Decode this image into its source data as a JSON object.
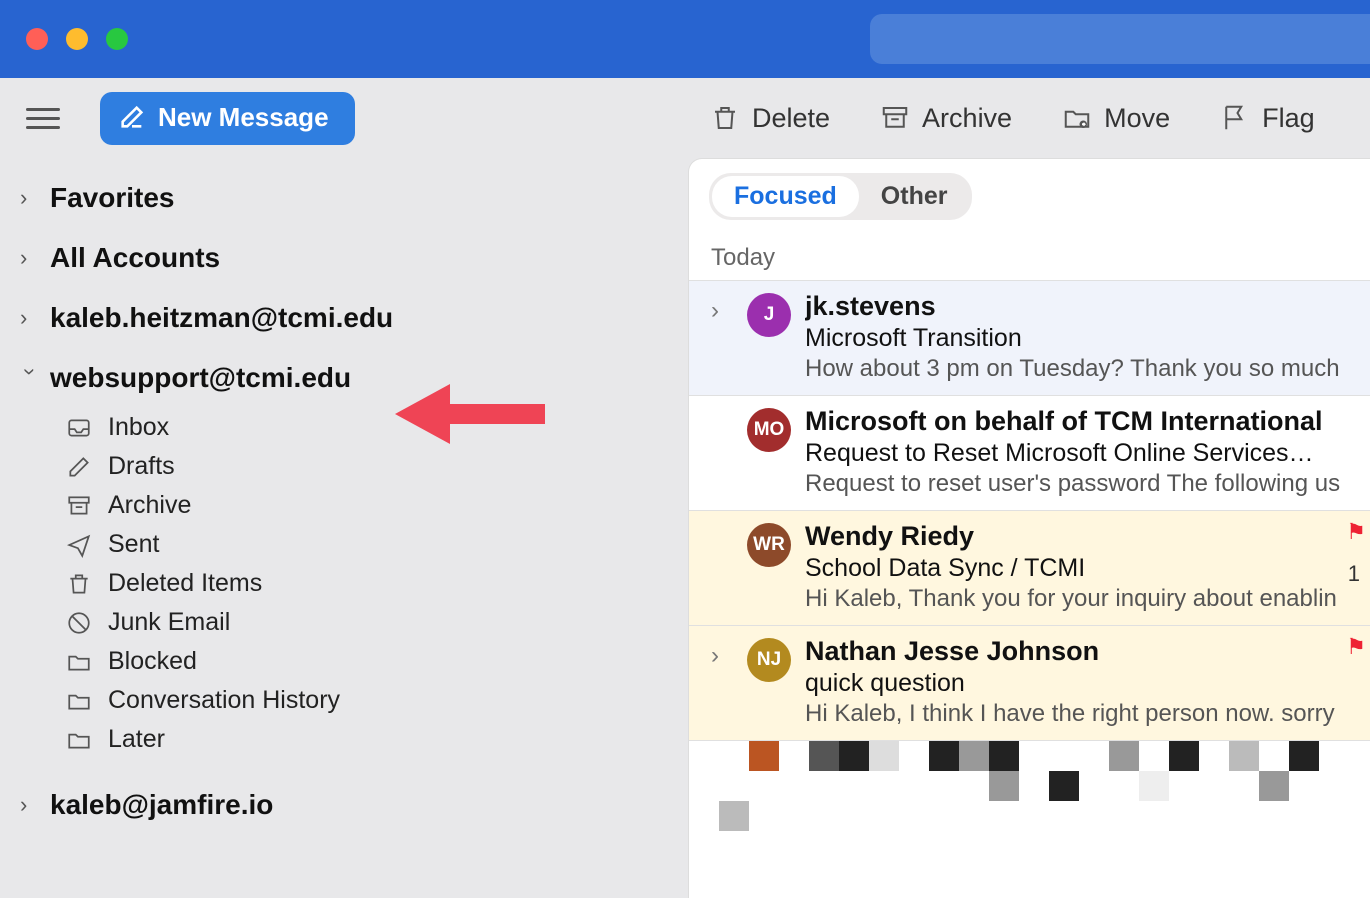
{
  "toolbar": {
    "new_message": "New Message",
    "delete": "Delete",
    "archive": "Archive",
    "move": "Move",
    "flag": "Flag"
  },
  "sidebar": {
    "favorites": "Favorites",
    "all_accounts": "All Accounts",
    "accounts": [
      {
        "email": "kaleb.heitzman@tcmi.edu",
        "expanded": false
      },
      {
        "email": "websupport@tcmi.edu",
        "expanded": true
      },
      {
        "email": "kaleb@jamfire.io",
        "expanded": false
      }
    ],
    "folders": [
      {
        "name": "Inbox",
        "icon": "inbox"
      },
      {
        "name": "Drafts",
        "icon": "drafts"
      },
      {
        "name": "Archive",
        "icon": "archive"
      },
      {
        "name": "Sent",
        "icon": "sent"
      },
      {
        "name": "Deleted Items",
        "icon": "trash"
      },
      {
        "name": "Junk Email",
        "icon": "junk"
      },
      {
        "name": "Blocked",
        "icon": "folder"
      },
      {
        "name": "Conversation History",
        "icon": "folder"
      },
      {
        "name": "Later",
        "icon": "folder"
      }
    ]
  },
  "tabs": {
    "focused": "Focused",
    "other": "Other"
  },
  "section_today": "Today",
  "emails": [
    {
      "sender": "jk.stevens",
      "subject": "Microsoft Transition",
      "preview": "How about 3 pm on Tuesday? Thank you so much",
      "avatar": "J",
      "avatar_color": "#9b2fae",
      "selected": true,
      "flagged": false,
      "expand": true
    },
    {
      "sender": "Microsoft on behalf of TCM International",
      "subject": "Request to Reset Microsoft Online Services…",
      "preview": "Request to reset user's password The following us",
      "avatar": "MO",
      "avatar_color": "#a22d2d",
      "selected": false,
      "flagged": false,
      "expand": false
    },
    {
      "sender": "Wendy Riedy",
      "subject": "School Data Sync / TCMI",
      "preview": "Hi Kaleb, Thank you for your inquiry about enablin",
      "avatar": "WR",
      "avatar_color": "#8d4a2a",
      "selected": false,
      "flagged": true,
      "count": "1",
      "expand": false
    },
    {
      "sender": "Nathan Jesse Johnson",
      "subject": "quick question",
      "preview": "Hi Kaleb, I think I have the right person now. sorry",
      "avatar": "NJ",
      "avatar_color": "#b38a1f",
      "selected": false,
      "flagged": true,
      "expand": true
    }
  ],
  "pixelated_colors": [
    "#fff",
    "#fff",
    "#b52",
    "#fff",
    "#555",
    "#222",
    "#ddd",
    "#fff",
    "#222",
    "#999",
    "#222",
    "#fff",
    "#fff",
    "#fff",
    "#999",
    "#fff",
    "#222",
    "#fff",
    "#bbb",
    "#fff",
    "#222",
    "#fff",
    "#fff",
    "#fff",
    "#fff",
    "#fff",
    "#fff",
    "#fff",
    "#fff",
    "#fff",
    "#fff",
    "#fff",
    "#999",
    "#fff",
    "#222",
    "#fff",
    "#fff",
    "#eee",
    "#fff",
    "#fff",
    "#fff",
    "#999",
    "#fff",
    "#fff",
    "#fff",
    "#bbb"
  ]
}
